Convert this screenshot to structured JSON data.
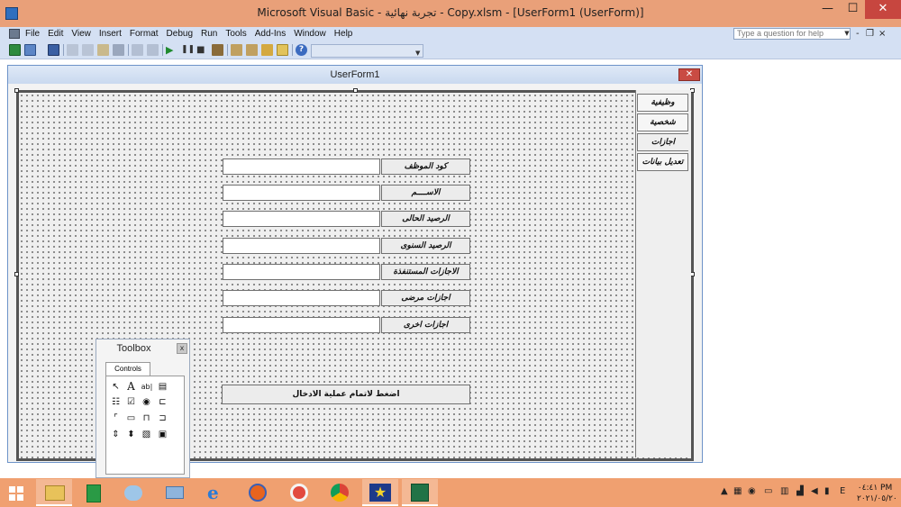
{
  "window": {
    "title": "Microsoft Visual Basic - تجربة نهائية - Copy.xlsm - [UserForm1 (UserForm)]",
    "minimize_glyph": "—",
    "maximize_glyph": "☐",
    "close_glyph": "✕"
  },
  "menubar": {
    "items": [
      "File",
      "Edit",
      "View",
      "Insert",
      "Format",
      "Debug",
      "Run",
      "Tools",
      "Add-Ins",
      "Window",
      "Help"
    ],
    "help_placeholder": "Type a question for help",
    "mdi_min": "-",
    "mdi_restore": "❐",
    "mdi_close": "×"
  },
  "toolbar": {
    "icons": [
      "excel-icon",
      "insert-userform-icon",
      "save-icon",
      "cut-icon",
      "copy-icon",
      "paste-icon",
      "find-icon",
      "undo-icon",
      "redo-icon",
      "run-icon",
      "break-icon",
      "reset-icon",
      "design-mode-icon",
      "project-explorer-icon",
      "properties-icon",
      "object-browser-icon",
      "toolbox-icon",
      "help-icon"
    ]
  },
  "designer": {
    "title": "UserForm1",
    "close_glyph": "✕"
  },
  "tabs": [
    {
      "label": "وظيفية",
      "active": false
    },
    {
      "label": "شخصية",
      "active": false
    },
    {
      "label": "اجازات",
      "active": true
    },
    {
      "label": "تعديل بيانات",
      "active": false
    }
  ],
  "fields": [
    {
      "label": "كود الموظف",
      "value": ""
    },
    {
      "label": "الاســــم",
      "value": ""
    },
    {
      "label": "الرصيد الحالى",
      "value": ""
    },
    {
      "label": "الرصيد السنوى",
      "value": ""
    },
    {
      "label": "الاجازات المستنفذة",
      "value": ""
    },
    {
      "label": "اجازات مرضى",
      "value": ""
    },
    {
      "label": "اجازات اخرى",
      "value": ""
    }
  ],
  "submit_label": "اضغط لاتمام عملية الادخال",
  "toolbox": {
    "title": "Toolbox",
    "close_glyph": "x",
    "tab_label": "Controls",
    "tools": [
      {
        "name": "select-objects-icon",
        "glyph": "↖"
      },
      {
        "name": "label-tool-icon",
        "glyph": "A"
      },
      {
        "name": "textbox-tool-icon",
        "glyph": "ab|"
      },
      {
        "name": "combobox-tool-icon",
        "glyph": "▤"
      },
      {
        "name": "listbox-tool-icon",
        "glyph": "☷"
      },
      {
        "name": "checkbox-tool-icon",
        "glyph": "☑"
      },
      {
        "name": "optionbutton-tool-icon",
        "glyph": "◉"
      },
      {
        "name": "togglebutton-tool-icon",
        "glyph": "⊏"
      },
      {
        "name": "frame-tool-icon",
        "glyph": "⌜"
      },
      {
        "name": "commandbutton-tool-icon",
        "glyph": "▭"
      },
      {
        "name": "tabstrip-tool-icon",
        "glyph": "⊓"
      },
      {
        "name": "multipage-tool-icon",
        "glyph": "⊐"
      },
      {
        "name": "scrollbar-tool-icon",
        "glyph": "⇕"
      },
      {
        "name": "spinbutton-tool-icon",
        "glyph": "⬍"
      },
      {
        "name": "image-tool-icon",
        "glyph": "▧"
      },
      {
        "name": "refedit-tool-icon",
        "glyph": "▣"
      }
    ]
  },
  "taskbar": {
    "apps": [
      "file-explorer-icon",
      "calculator-icon",
      "paint-icon",
      "tablet-icon",
      "internet-explorer-icon",
      "firefox-icon",
      "opera-icon",
      "chrome-icon",
      "star-app-icon",
      "excel-taskbar-icon"
    ],
    "language": "E",
    "clock_time": "٠٤:٤١ PM",
    "clock_date": "٢٠٢١/٠٥/٢٠"
  }
}
